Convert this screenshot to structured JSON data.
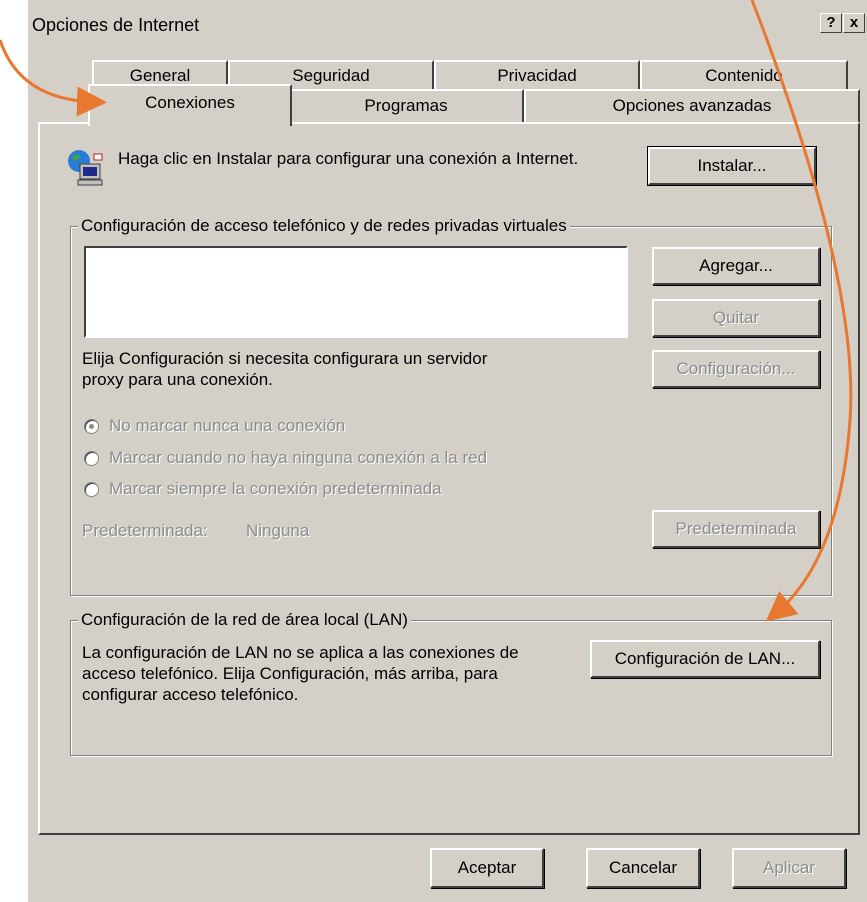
{
  "window": {
    "title": "Opciones de Internet",
    "help_label": "?",
    "close_label": "x"
  },
  "tabs": {
    "row1": [
      "General",
      "Seguridad",
      "Privacidad",
      "Contenido"
    ],
    "row2": [
      "Conexiones",
      "Programas",
      "Opciones avanzadas"
    ],
    "active": "Conexiones"
  },
  "setup": {
    "text": "Haga clic en Instalar para configurar una conexión a Internet.",
    "install_button": "Instalar..."
  },
  "dialup": {
    "legend": "Configuración de acceso telefónico y de redes privadas virtuales",
    "add_button": "Agregar...",
    "remove_button": "Quitar",
    "settings_button": "Configuración...",
    "proxy_text": "Elija Configuración si necesita configurara un servidor proxy para una conexión.",
    "radio_never": "No marcar nunca una conexión",
    "radio_when_none": "Marcar cuando no haya ninguna conexión a la red",
    "radio_always": "Marcar siempre la conexión predeterminada",
    "default_label": "Predeterminada:",
    "default_value": "Ninguna",
    "default_button": "Predeterminada"
  },
  "lan": {
    "legend": "Configuración de la red de área local (LAN)",
    "text": "La configuración de LAN no se aplica a las conexiones de acceso telefónico. Elija Configuración, más arriba, para configurar acceso telefónico.",
    "lan_button": "Configuración de LAN..."
  },
  "footer": {
    "ok": "Aceptar",
    "cancel": "Cancelar",
    "apply": "Aplicar"
  },
  "colors": {
    "face": "#d4d0c8",
    "annotation_arrow": "#e87830",
    "disabled_text": "#8c8c8c"
  }
}
